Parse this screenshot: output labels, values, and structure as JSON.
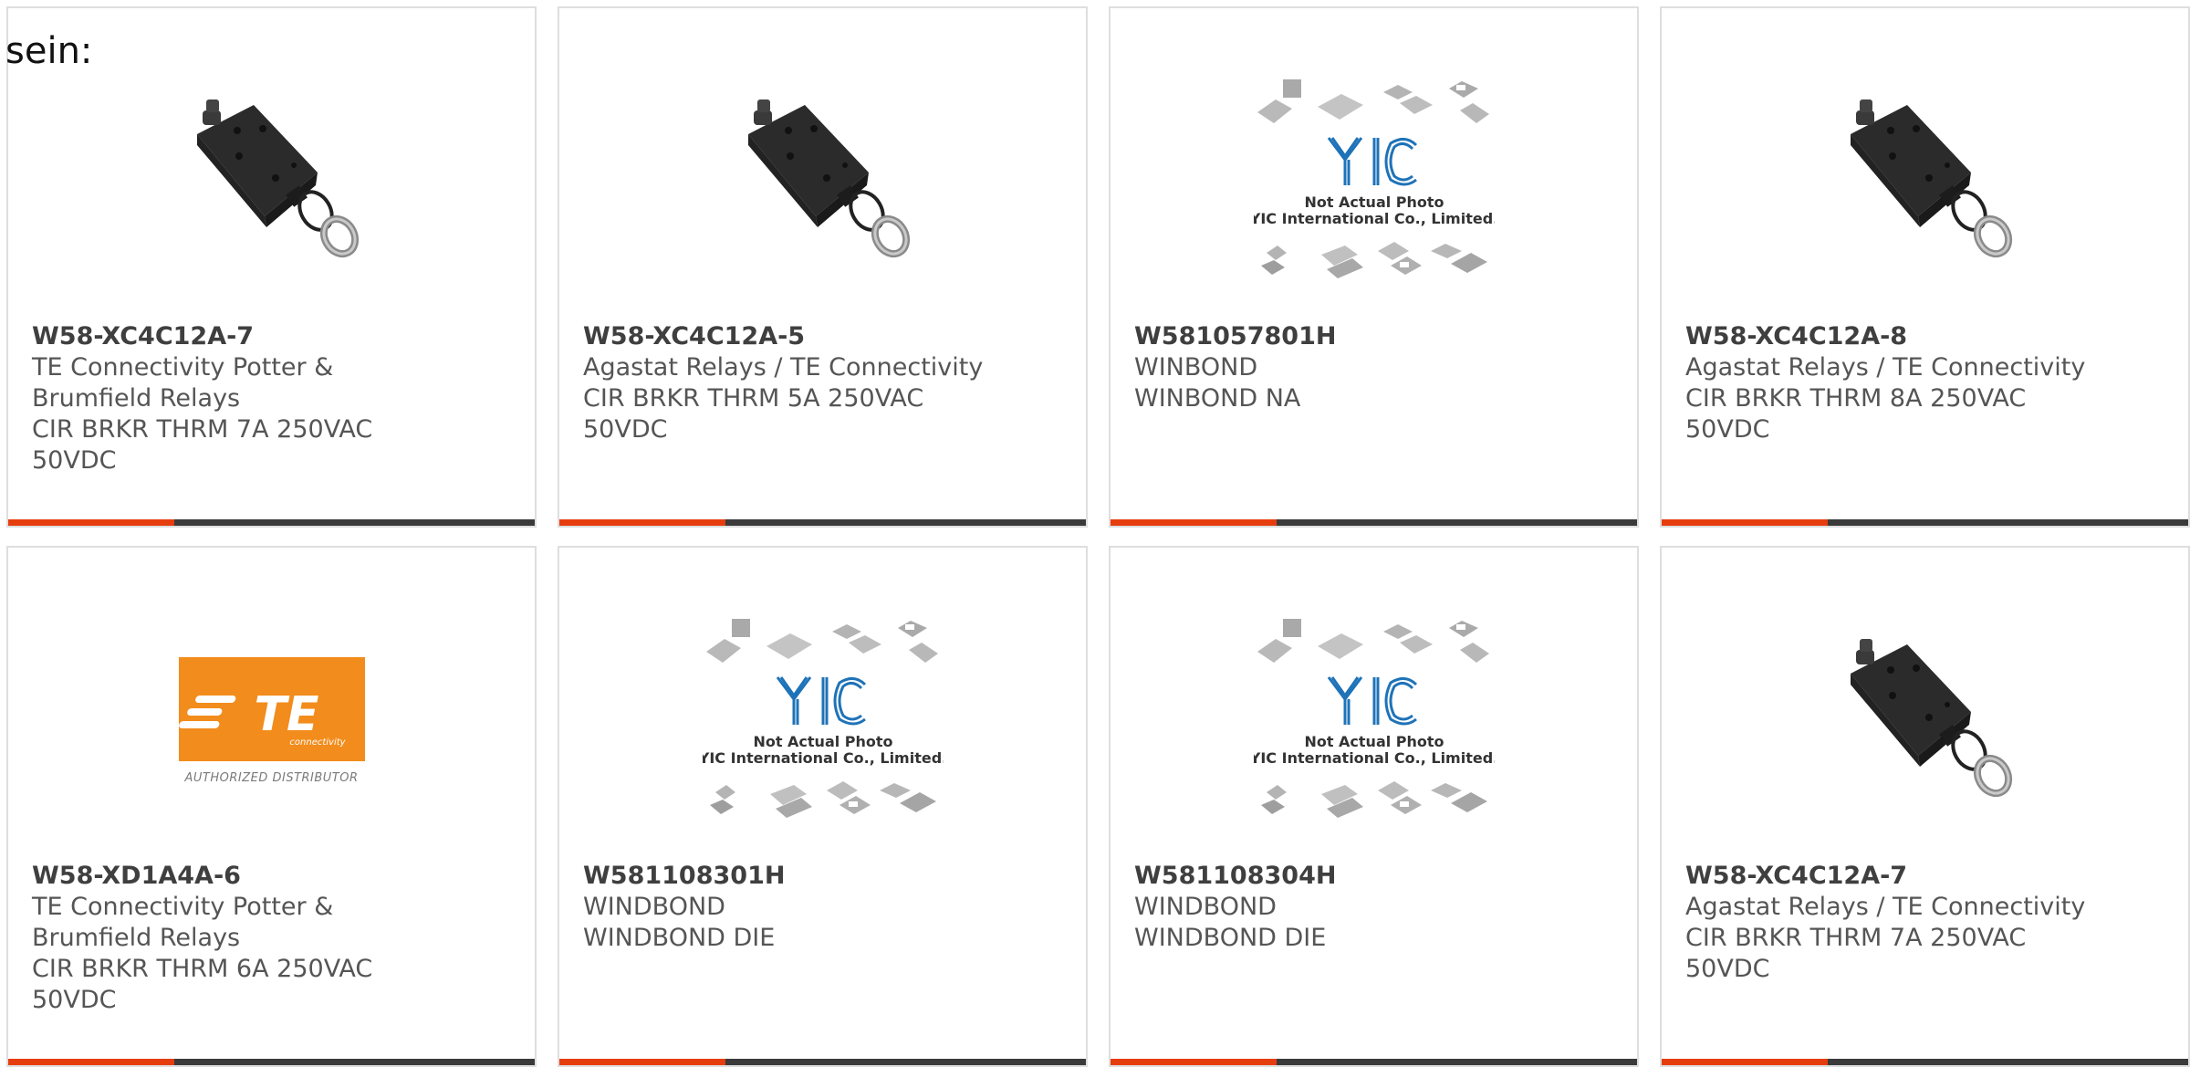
{
  "intro_text": "sein:",
  "colors": {
    "accent": "#e63d0f",
    "bar": "#3a3a3a",
    "border": "#dedede",
    "te_orange": "#f28c1c",
    "yic_blue": "#1e73b8"
  },
  "products": [
    {
      "part_number": "W58-XC4C12A-7",
      "lines": [
        "TE Connectivity Potter &",
        "Brumfield Relays",
        "CIR BRKR THRM 7A 250VAC",
        "50VDC"
      ],
      "image": "breaker"
    },
    {
      "part_number": "W58-XC4C12A-5",
      "lines": [
        "Agastat Relays / TE Connectivity",
        "CIR BRKR THRM 5A 250VAC",
        "50VDC"
      ],
      "image": "breaker"
    },
    {
      "part_number": "W581057801H",
      "lines": [
        "WINBOND",
        "WINBOND NA"
      ],
      "image": "yic"
    },
    {
      "part_number": "W58-XC4C12A-8",
      "lines": [
        "Agastat Relays / TE Connectivity",
        "CIR BRKR THRM 8A 250VAC",
        "50VDC"
      ],
      "image": "breaker"
    },
    {
      "part_number": "W58-XD1A4A-6",
      "lines": [
        "TE Connectivity Potter &",
        "Brumfield Relays",
        "CIR BRKR THRM 6A 250VAC",
        "50VDC"
      ],
      "image": "te-logo"
    },
    {
      "part_number": "W581108301H",
      "lines": [
        "WINDBOND",
        "WINDBOND DIE"
      ],
      "image": "yic"
    },
    {
      "part_number": "W581108304H",
      "lines": [
        "WINDBOND",
        "WINDBOND DIE"
      ],
      "image": "yic"
    },
    {
      "part_number": "W58-XC4C12A-7",
      "lines": [
        "Agastat Relays / TE Connectivity",
        "CIR BRKR THRM 7A 250VAC",
        "50VDC"
      ],
      "image": "breaker"
    }
  ],
  "yic_caption": [
    "Not Actual Photo",
    "YIC International Co., Limited."
  ],
  "te_logo": {
    "text": "TE",
    "sub": "connectivity",
    "caption": "AUTHORIZED DISTRIBUTOR"
  }
}
